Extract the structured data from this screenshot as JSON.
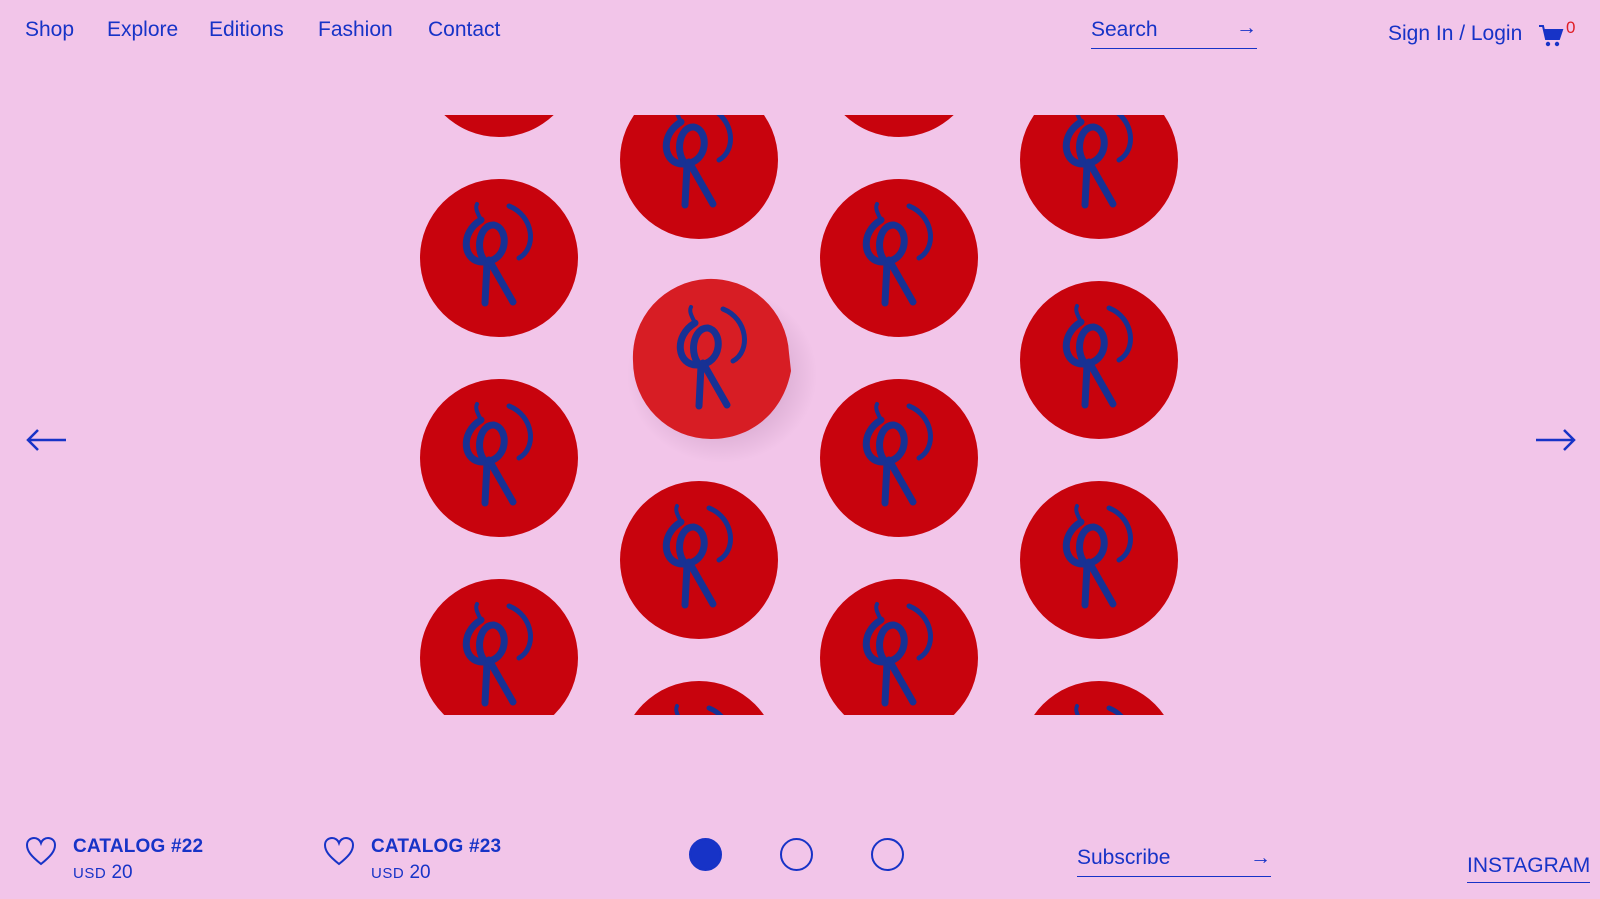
{
  "nav": {
    "items": [
      {
        "label": "Shop"
      },
      {
        "label": "Explore"
      },
      {
        "label": "Editions"
      },
      {
        "label": "Fashion"
      },
      {
        "label": "Contact"
      }
    ]
  },
  "search": {
    "label": "Search",
    "arrow": "→"
  },
  "account": {
    "signin_label": "Sign In / Login",
    "cart_count": "0"
  },
  "carousel": {
    "prev_arrow": "←",
    "next_arrow": "→",
    "active_index": 0,
    "slide_count": 3
  },
  "products": [
    {
      "title": "CATALOG #22",
      "currency": "USD",
      "price": "20"
    },
    {
      "title": "CATALOG #23",
      "currency": "USD",
      "price": "20"
    }
  ],
  "subscribe": {
    "label": "Subscribe",
    "arrow": "→"
  },
  "social": {
    "instagram_label": "INSTAGRAM"
  },
  "colors": {
    "background": "#f2c5e9",
    "accent": "#1733c7",
    "sticker_red": "#c8030d",
    "badge_red": "#e01d25"
  },
  "icons": [
    "search-arrow-icon",
    "cart-icon",
    "heart-icon",
    "arrow-left-icon",
    "arrow-right-icon"
  ]
}
